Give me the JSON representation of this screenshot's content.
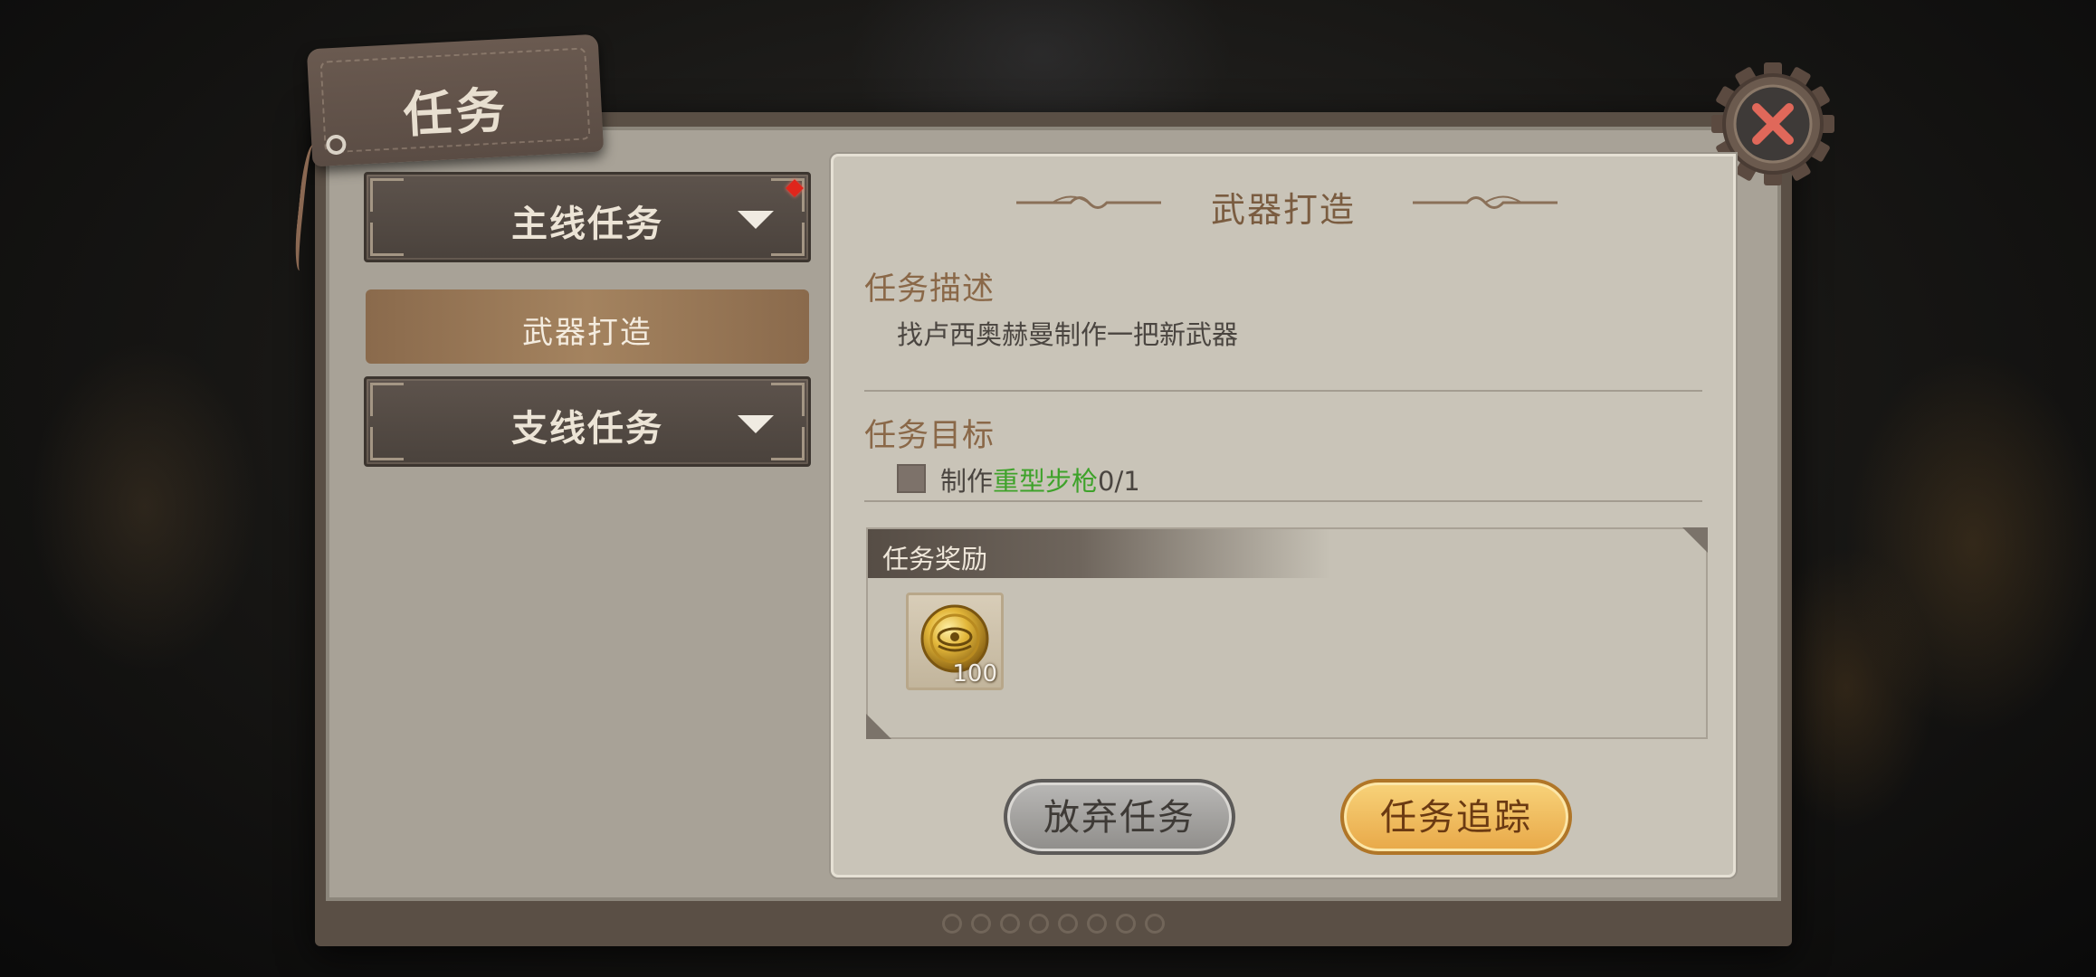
{
  "header": {
    "title": "任务"
  },
  "sidebar": {
    "categories": [
      {
        "label": "主线任务",
        "has_alert": true
      },
      {
        "label": "支线任务",
        "has_alert": false
      }
    ],
    "selected_task": "武器打造"
  },
  "detail": {
    "title": "武器打造",
    "description_heading": "任务描述",
    "description": "找卢西奥赫曼制作一把新武器",
    "objective_heading": "任务目标",
    "objective": {
      "prefix": "制作",
      "target": "重型步枪",
      "progress": "0/1"
    },
    "reward_heading": "任务奖励",
    "rewards": [
      {
        "icon": "gold-coin-icon",
        "count": "100"
      }
    ]
  },
  "actions": {
    "abandon_label": "放弃任务",
    "track_label": "任务追踪"
  },
  "colors": {
    "accent_green": "#3ea22a",
    "alert_red": "#e0261c",
    "gold_button": "#f0bd60"
  }
}
